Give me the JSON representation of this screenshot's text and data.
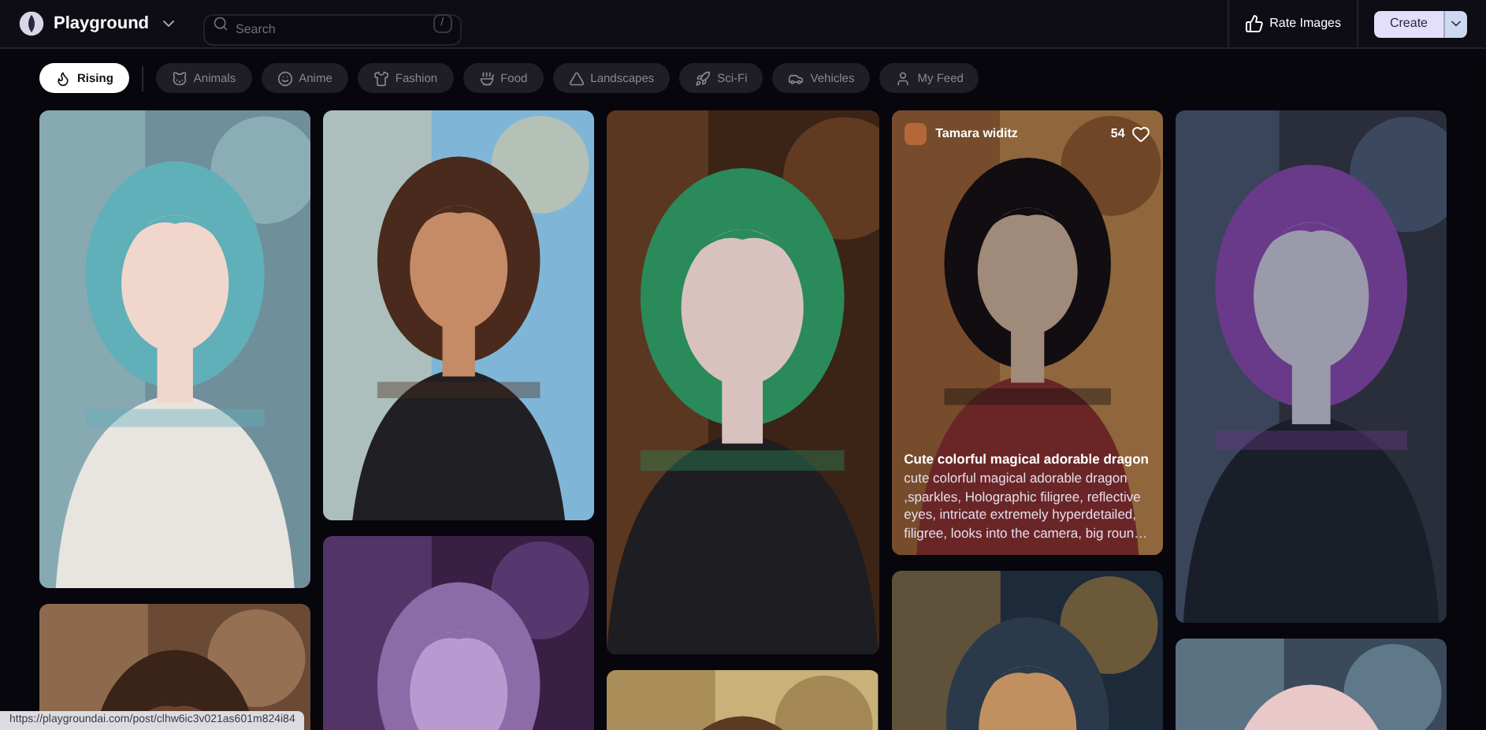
{
  "header": {
    "logo_text": "Playground",
    "search": {
      "placeholder": "Search",
      "shortcut": "/"
    },
    "rate_button": "Rate Images",
    "create_button": "Create"
  },
  "filters": [
    {
      "label": "Rising",
      "selected": true
    },
    {
      "label": "Animals",
      "selected": false
    },
    {
      "label": "Anime",
      "selected": false
    },
    {
      "label": "Fashion",
      "selected": false
    },
    {
      "label": "Food",
      "selected": false
    },
    {
      "label": "Landscapes",
      "selected": false
    },
    {
      "label": "Sci-Fi",
      "selected": false
    },
    {
      "label": "Vehicles",
      "selected": false
    },
    {
      "label": "My Feed",
      "selected": false
    }
  ],
  "gallery": {
    "columns": [
      [
        {
          "kind": "picture"
        },
        {
          "kind": "picture"
        }
      ],
      [
        {
          "kind": "picture"
        },
        {
          "kind": "picture"
        }
      ],
      [
        {
          "kind": "picture"
        },
        {
          "kind": "picture"
        }
      ],
      [
        {
          "kind": "post",
          "author": "Tamara widitz",
          "likes": "54",
          "title": "Cute colorful magical adorable dragon",
          "description": "cute colorful magical adorable dragon ,sparkles, Holographic filigree, reflective eyes, intricate extremely hyperdetailed, filigree, looks into the camera, big roun…"
        },
        {
          "kind": "picture"
        }
      ],
      [
        {
          "kind": "picture"
        },
        {
          "kind": "picture"
        }
      ]
    ]
  },
  "status_url": "https://playgroundai.com/post/clhw6ic3v021as601m824i84"
}
